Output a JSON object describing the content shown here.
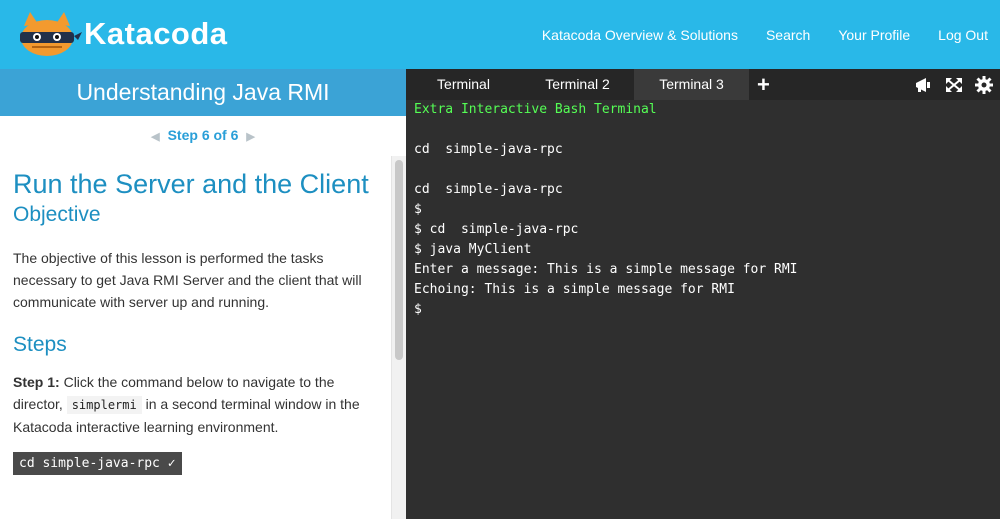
{
  "nav": {
    "brand": "Katacoda",
    "links": [
      "Katacoda Overview & Solutions",
      "Search",
      "Your Profile",
      "Log Out"
    ]
  },
  "course": {
    "title": "Understanding Java RMI"
  },
  "stepnav": {
    "label": "Step 6 of 6"
  },
  "content": {
    "title": "Run the Server and the Client",
    "objective_heading": "Objective",
    "objective_text": "The objective of this lesson is performed the tasks necessary to get Java RMI Server and the client that will communicate with server up and running.",
    "steps_heading": "Steps",
    "step1_label": "Step 1:",
    "step1_text_a": " Click the command below to navigate to the director,",
    "step1_code": "simplermi",
    "step1_text_b": " in a second terminal window in the Katacoda interactive learning environment.",
    "command": "cd  simple-java-rpc ✓"
  },
  "terminal": {
    "tabs": [
      "Terminal",
      "Terminal 2",
      "Terminal 3"
    ],
    "active_tab": 2,
    "lines": [
      {
        "text": "Extra Interactive Bash Terminal",
        "green": true
      },
      {
        "text": ""
      },
      {
        "text": "cd  simple-java-rpc"
      },
      {
        "text": ""
      },
      {
        "text": "cd  simple-java-rpc"
      },
      {
        "text": "$"
      },
      {
        "text": "$ cd  simple-java-rpc"
      },
      {
        "text": "$ java MyClient"
      },
      {
        "text": "Enter a message: This is a simple message for RMI"
      },
      {
        "text": "Echoing: This is a simple message for RMI"
      },
      {
        "text": "$"
      }
    ]
  },
  "colors": {
    "header": "#29b8e8",
    "course_bar": "#3ba3d6",
    "accent": "#1d8fc1",
    "terminal_bg": "#2f2f2f",
    "terminal_green": "#55ff55"
  },
  "icons": [
    "ninja-cat-logo",
    "arrow-left-icon",
    "arrow-right-icon",
    "plus-icon",
    "megaphone-icon",
    "fullscreen-icon",
    "gear-icon",
    "check-icon"
  ]
}
